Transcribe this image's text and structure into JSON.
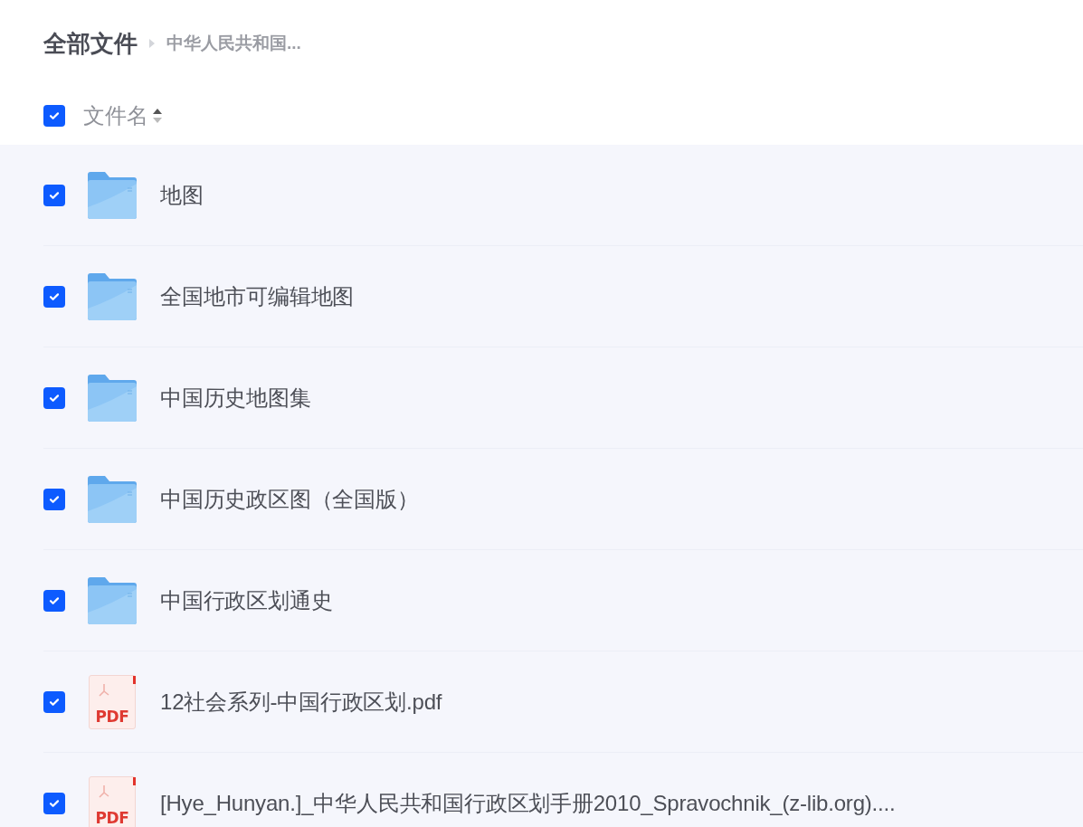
{
  "breadcrumb": {
    "root": "全部文件",
    "current": "中华人民共和国..."
  },
  "header": {
    "checked": true,
    "column": "文件名"
  },
  "files": [
    {
      "kind": "folder",
      "name": "地图",
      "checked": true
    },
    {
      "kind": "folder",
      "name": "全国地市可编辑地图",
      "checked": true
    },
    {
      "kind": "folder",
      "name": "中国历史地图集",
      "checked": true
    },
    {
      "kind": "folder",
      "name": "中国历史政区图（全国版）",
      "checked": true
    },
    {
      "kind": "folder",
      "name": "中国行政区划通史",
      "checked": true
    },
    {
      "kind": "pdf",
      "badge": "PDF",
      "name": "12社会系列-中国行政区划.pdf",
      "checked": true
    },
    {
      "kind": "pdf",
      "badge": "PDF",
      "name": "[Hye_Hunyan.]_中华人民共和国行政区划手册2010_Spravochnik_(z-lib.org)....",
      "checked": true
    }
  ]
}
